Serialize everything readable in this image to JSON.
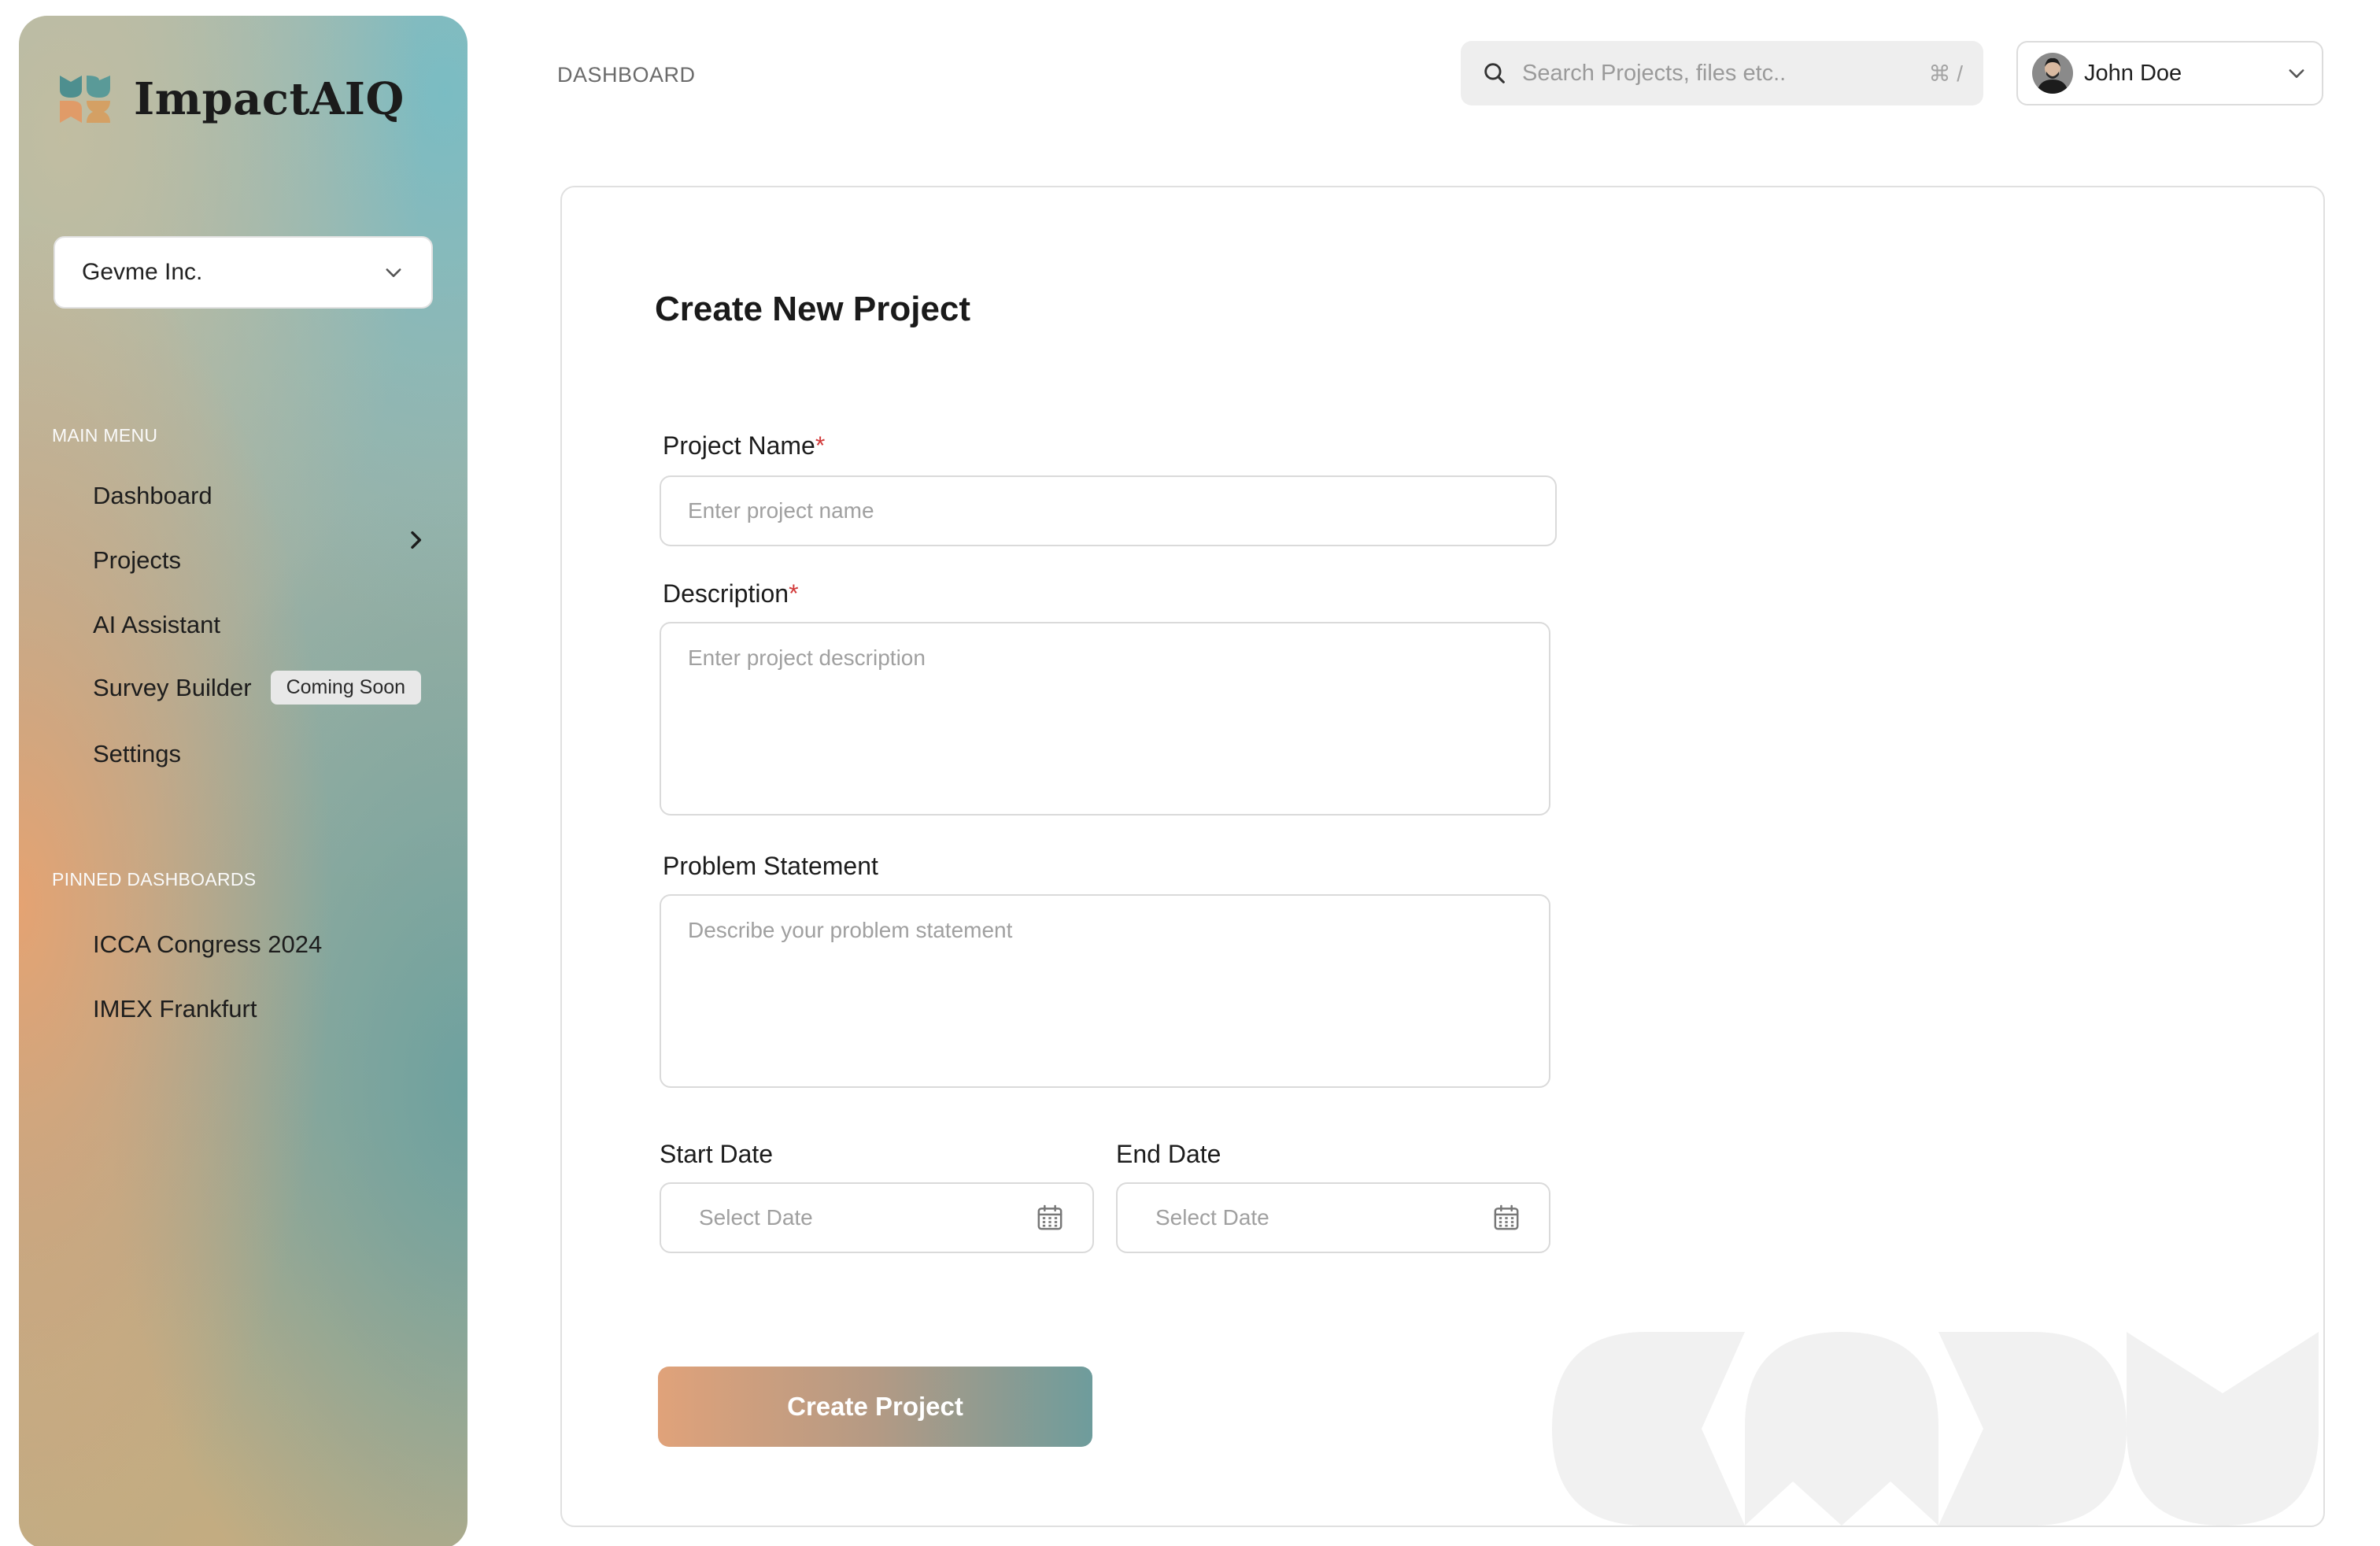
{
  "app": {
    "name": "ImpactAIQ"
  },
  "org_select": {
    "value": "Gevme Inc."
  },
  "sidebar": {
    "main_menu_label": "MAIN MENU",
    "items": [
      {
        "label": "Dashboard"
      },
      {
        "label": "Projects",
        "has_submenu": true
      },
      {
        "label": "AI Assistant"
      },
      {
        "label": "Survey Builder",
        "badge": "Coming Soon"
      },
      {
        "label": "Settings"
      }
    ],
    "pinned_label": "PINNED DASHBOARDS",
    "pinned": [
      {
        "label": "ICCA Congress 2024"
      },
      {
        "label": "IMEX Frankfurt"
      }
    ]
  },
  "header": {
    "breadcrumb": "DASHBOARD",
    "search_placeholder": "Search Projects, files etc..",
    "search_shortcut": "⌘ /",
    "user_name": "John Doe"
  },
  "form": {
    "title": "Create New Project",
    "required_mark": "*",
    "project_name": {
      "label": "Project Name",
      "placeholder": "Enter project name",
      "required": true
    },
    "description": {
      "label": "Description",
      "placeholder": "Enter project description",
      "required": true
    },
    "problem_statement": {
      "label": "Problem Statement",
      "placeholder": "Describe your problem statement"
    },
    "start_date": {
      "label": "Start Date",
      "placeholder": "Select Date"
    },
    "end_date": {
      "label": "End Date",
      "placeholder": "Select Date"
    },
    "submit_label": "Create Project"
  },
  "colors": {
    "accent_orange": "#e0a27a",
    "accent_teal": "#6e9c9c",
    "required": "#d23a3a"
  }
}
